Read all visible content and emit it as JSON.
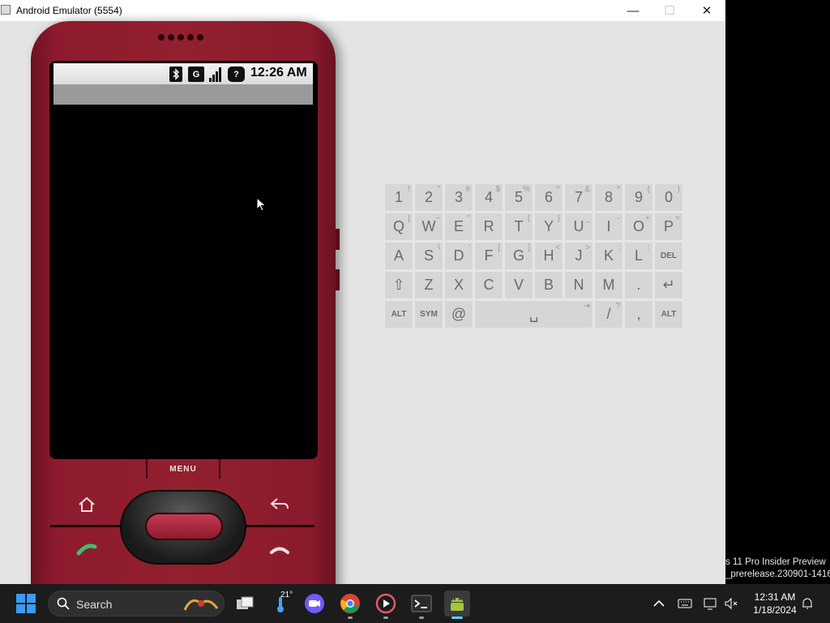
{
  "window": {
    "title": "Android Emulator (5554)",
    "minimize_label": "—",
    "maximize_label": "☐",
    "close_label": "✕"
  },
  "phone": {
    "status_bar": {
      "time": "12:26 AM",
      "data_icon_letter": "G",
      "unknown_icon_label": "?",
      "icons": [
        "bluetooth-icon",
        "data-icon",
        "signal-icon",
        "unknown-icon"
      ]
    },
    "menu_label": "MENU"
  },
  "keyboard": {
    "rows": [
      [
        {
          "k": "1",
          "s": "!"
        },
        {
          "k": "2",
          "s": "\""
        },
        {
          "k": "3",
          "s": "#"
        },
        {
          "k": "4",
          "s": "$"
        },
        {
          "k": "5",
          "s": "%"
        },
        {
          "k": "6",
          "s": "^"
        },
        {
          "k": "7",
          "s": "&"
        },
        {
          "k": "8",
          "s": "*"
        },
        {
          "k": "9",
          "s": "("
        },
        {
          "k": "0",
          "s": ")"
        }
      ],
      [
        {
          "k": "Q",
          "s": "|"
        },
        {
          "k": "W",
          "s": "~"
        },
        {
          "k": "E",
          "s": "\""
        },
        {
          "k": "R",
          "s": "`"
        },
        {
          "k": "T",
          "s": "{"
        },
        {
          "k": "Y",
          "s": "}"
        },
        {
          "k": "U",
          "s": "_"
        },
        {
          "k": "I",
          "s": "-"
        },
        {
          "k": "O",
          "s": "+"
        },
        {
          "k": "P",
          "s": "="
        }
      ],
      [
        {
          "k": "A",
          "s": ""
        },
        {
          "k": "S",
          "s": "\\"
        },
        {
          "k": "D",
          "s": "'"
        },
        {
          "k": "F",
          "s": "["
        },
        {
          "k": "G",
          "s": "]"
        },
        {
          "k": "H",
          "s": "<"
        },
        {
          "k": "J",
          "s": ">"
        },
        {
          "k": "K",
          "s": ";"
        },
        {
          "k": "L",
          "s": ":"
        },
        {
          "k": "DEL",
          "s": ""
        }
      ],
      [
        {
          "k": "⇧",
          "s": ""
        },
        {
          "k": "Z",
          "s": ""
        },
        {
          "k": "X",
          "s": ""
        },
        {
          "k": "C",
          "s": ""
        },
        {
          "k": "V",
          "s": ""
        },
        {
          "k": "B",
          "s": ""
        },
        {
          "k": "N",
          "s": ""
        },
        {
          "k": "M",
          "s": ""
        },
        {
          "k": ".",
          "s": ""
        },
        {
          "k": "↵",
          "s": ""
        }
      ],
      [
        {
          "k": "ALT",
          "s": ""
        },
        {
          "k": "SYM",
          "s": ""
        },
        {
          "k": "@",
          "s": ""
        },
        {
          "k": "␣",
          "s": "⇥"
        },
        {
          "k": "/",
          "s": "?"
        },
        {
          "k": ",",
          "s": ""
        },
        {
          "k": "ALT",
          "s": ""
        }
      ]
    ]
  },
  "watermark": {
    "line1": "s 11 Pro Insider Preview",
    "line2": "_prerelease.230901-1416"
  },
  "taskbar": {
    "search_placeholder": "Search",
    "weather_temp": "21°",
    "apps": [
      "task-view",
      "zoom",
      "chrome",
      "media-player",
      "terminal",
      "android-emulator"
    ],
    "active_app": "android-emulator",
    "time": "12:31 AM",
    "date": "1/18/2024"
  },
  "colors": {
    "phone_body": "#8d1a2e",
    "taskbar": "#1c1c1c",
    "accent": "#60cdff"
  }
}
